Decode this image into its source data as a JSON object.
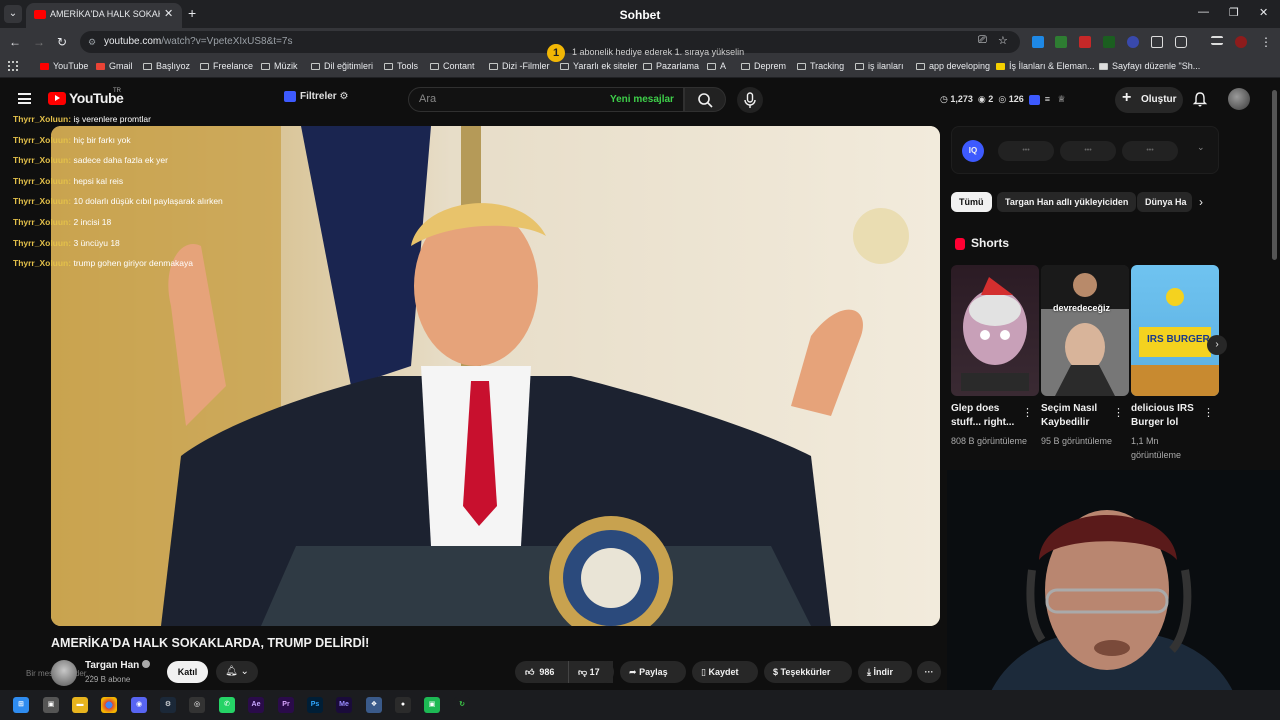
{
  "browser": {
    "tab_title": "AMERİKA'DA HALK SOKAKLARDA",
    "window_title": "Sohbet",
    "url_host": "youtube.com",
    "url_path": "/watch?v=VpeteXIxUS8&t=7s",
    "bookmarks": [
      "YouTube",
      "Gmail",
      "Başlıyoz",
      "Freelance",
      "Müzik",
      "Dil eğitimleri",
      "Tools",
      "Contant",
      "Dizi -Filmler",
      "Yararlı ek siteler",
      "Pazarlama",
      "A",
      "Deprem",
      "Tracking",
      "iş ilanları",
      "app developing",
      "İş İlanları & Eleman...",
      "Sayfayı düzenle \"Sh..."
    ]
  },
  "overlay": {
    "badge": "1",
    "subscriber_note": "1 abonelik hediye ederek 1. sıraya yükselin"
  },
  "youtube": {
    "logo": "YouTube",
    "region": "TR",
    "filters_label": "Filtreler",
    "search_placeholder": "Ara",
    "new_messages": "Yeni mesajlar",
    "stats": {
      "views": "1,273",
      "second": "2",
      "third": "126"
    },
    "create_label": "Oluştur"
  },
  "chat": [
    {
      "user": "Thyrr_Xoluun",
      "message": "iş verenlere promtlar"
    },
    {
      "user": "Thyrr_Xoluun",
      "message": "hiç bir farkı yok"
    },
    {
      "user": "Thyrr_Xoluun",
      "message": "sadece daha fazla ek yer"
    },
    {
      "user": "Thyrr_Xoluun",
      "message": "hepsi kal reis"
    },
    {
      "user": "Thyrr_Xoluun",
      "message": "10 dolarlı düşük cıbıl paylaşarak alırken"
    },
    {
      "user": "Thyrr_Xoluun",
      "message": "2 incisi 18"
    },
    {
      "user": "Thyrr_Xoluun",
      "message": "3 üncüyu 18"
    },
    {
      "user": "Thyrr_Xoluun",
      "message": "trump gohen giriyor denmakaya"
    }
  ],
  "video": {
    "title": "AMERİKA'DA HALK SOKAKLARDA, TRUMP DELİRDİ!",
    "channel": "Targan Han",
    "subscribers": "229 B abone",
    "ghost_text": "Bir mesaj gönder...",
    "join": "Katıl",
    "likes": "986",
    "dislikes": "17",
    "share": "Paylaş",
    "save": "Kaydet",
    "thanks": "Teşekkürler",
    "download": "İndir"
  },
  "sidebar": {
    "ext_logo": "IQ",
    "chips": [
      "Tümü",
      "Targan Han adlı yükleyiciden",
      "Dünya Ha"
    ],
    "shorts_heading": "Shorts",
    "shorts": [
      {
        "title": "Glep does stuff... right...",
        "views": "808 B görüntüleme",
        "overlay": ""
      },
      {
        "title": "Seçim Nasıl Kaybedilir",
        "views": "95 B görüntüleme",
        "overlay": "devredeceğiz"
      },
      {
        "title": "delicious IRS Burger lol",
        "views": "1,1 Mn görüntüleme",
        "overlay": "IRS BURGER"
      }
    ]
  },
  "colors": {
    "youtube_red": "#ff0000",
    "chat_username": "#e3c04a",
    "new_messages_green": "#3ecf4a",
    "background": "#0f0f0f"
  }
}
